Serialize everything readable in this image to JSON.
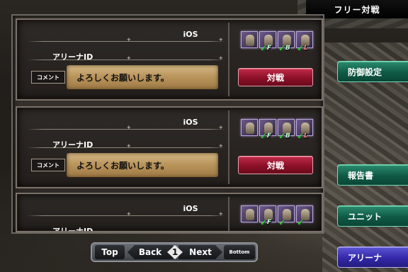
{
  "header": {
    "title": "フリー対戦"
  },
  "cards": [
    {
      "os": "iOS",
      "arena_id_label": "アリーナID",
      "comment_label": "コメント",
      "comment_text": "よろしくお願いします。",
      "battle_label": "対戦",
      "units": [
        {
          "pos": "",
          "check": ""
        },
        {
          "pos": "F",
          "check": "✓"
        },
        {
          "pos": "B",
          "check": "✓"
        },
        {
          "pos": "L",
          "check": "✓"
        }
      ]
    },
    {
      "os": "iOS",
      "arena_id_label": "アリーナID",
      "comment_label": "コメント",
      "comment_text": "よろしくお願いします。",
      "battle_label": "対戦",
      "units": [
        {
          "pos": "",
          "check": ""
        },
        {
          "pos": "F",
          "check": "✓"
        },
        {
          "pos": "B",
          "check": "✓"
        },
        {
          "pos": "L",
          "check": "✓"
        }
      ]
    },
    {
      "os": "iOS",
      "arena_id_label": "アリーナID",
      "units": [
        {
          "pos": "",
          "check": ""
        },
        {
          "pos": "F",
          "check": "✓"
        },
        {
          "pos": "",
          "check": "✓"
        },
        {
          "pos": "",
          "check": "✓"
        }
      ]
    }
  ],
  "side_menu": {
    "defense": "防御設定",
    "report": "報告書",
    "unit": "ユニット",
    "arena": "アリーナ"
  },
  "pager": {
    "top": "Top",
    "back": "Back",
    "page": "1",
    "next": "Next",
    "bottom": "Bottom"
  }
}
